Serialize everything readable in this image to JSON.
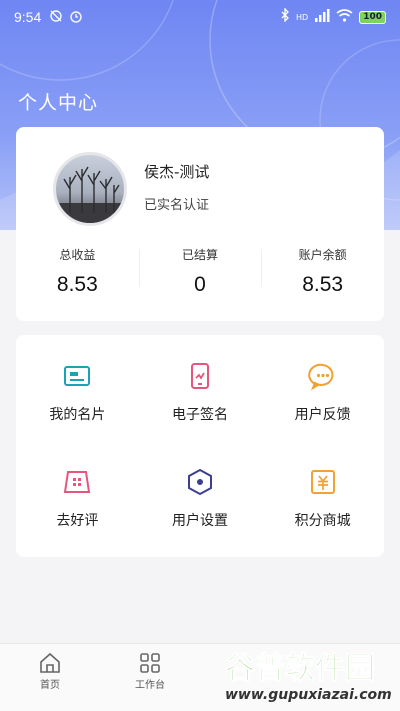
{
  "status_bar": {
    "time": "9:54",
    "left_icons": [
      "alarm-off-icon",
      "alarm-clock-icon"
    ],
    "right_icons": [
      "bluetooth-icon",
      "signal-icon",
      "wifi-icon"
    ],
    "network_label": "HD",
    "battery": "100"
  },
  "page": {
    "title": "个人中心"
  },
  "profile": {
    "name": "侯杰-测试",
    "status": "已实名认证",
    "stats": [
      {
        "label": "总收益",
        "value": "8.53"
      },
      {
        "label": "已结算",
        "value": "0"
      },
      {
        "label": "账户余额",
        "value": "8.53"
      }
    ]
  },
  "menu": {
    "items": [
      {
        "label": "我的名片",
        "icon": "business-card-icon",
        "color": "#1aa3b3"
      },
      {
        "label": "电子签名",
        "icon": "e-signature-icon",
        "color": "#e4577a"
      },
      {
        "label": "用户反馈",
        "icon": "feedback-chat-icon",
        "color": "#f0a234"
      },
      {
        "label": "去好评",
        "icon": "rate-store-icon",
        "color": "#e4577a"
      },
      {
        "label": "用户设置",
        "icon": "settings-hex-icon",
        "color": "#3d3f8f"
      },
      {
        "label": "积分商城",
        "icon": "points-mall-icon",
        "color": "#f0a234"
      }
    ]
  },
  "tabbar": {
    "items": [
      {
        "label": "首页",
        "icon": "home-icon"
      },
      {
        "label": "工作台",
        "icon": "workbench-grid-icon"
      }
    ]
  },
  "watermark": {
    "title": "谷普软件园",
    "url": "www.gupuxiazai.com"
  },
  "colors": {
    "hero_start": "#6f86f3",
    "hero_end": "#b5c2f8",
    "background": "#f4f4f6"
  }
}
